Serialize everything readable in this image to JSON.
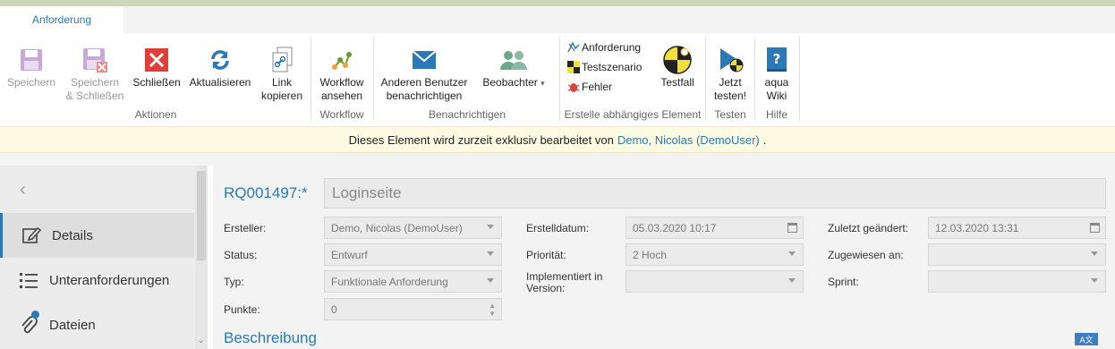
{
  "tab": {
    "label": "Anforderung"
  },
  "ribbon": {
    "buttons": {
      "save": "Speichern",
      "save_close_1": "Speichern",
      "save_close_2": "& Schließen",
      "close": "Schließen",
      "refresh": "Aktualisieren",
      "copy_link_1": "Link",
      "copy_link_2": "kopieren",
      "workflow_1": "Workflow",
      "workflow_2": "ansehen",
      "notify_1": "Anderen Benutzer",
      "notify_2": "benachrichtigen",
      "observers": "Beobachter",
      "dep_requirement": "Anforderung",
      "dep_testscenario": "Testszenario",
      "dep_bug": "Fehler",
      "testcase": "Testfall",
      "test_now_1": "Jetzt",
      "test_now_2": "testen!",
      "wiki_1": "aqua",
      "wiki_2": "Wiki"
    },
    "groups": {
      "actions": "Aktionen",
      "workflow": "Workflow",
      "notify": "Benachrichtigen",
      "create_dependent": "Erstelle abhängiges Element",
      "test": "Testen",
      "help": "Hilfe"
    }
  },
  "banner": {
    "text": "Dieses Element wird zurzeit exklusiv bearbeitet von",
    "user": "Demo, Nicolas (DemoUser)",
    "suffix": "."
  },
  "sidebar": {
    "back": "‹",
    "items": [
      {
        "label": "Details",
        "icon": "edit-icon",
        "active": true
      },
      {
        "label": "Unteranforderungen",
        "icon": "list-icon",
        "active": false
      },
      {
        "label": "Dateien",
        "icon": "paperclip-icon",
        "active": false
      }
    ]
  },
  "form": {
    "id": "RQ001497:*",
    "title": "Loginseite",
    "creator_label": "Ersteller:",
    "creator": "Demo, Nicolas (DemoUser)",
    "status_label": "Status:",
    "status": "Entwurf",
    "type_label": "Typ:",
    "type": "Funktionale Anforderung",
    "points_label": "Punkte:",
    "points": "0",
    "created_label": "Erstelldatum:",
    "created": "05.03.2020 10:17",
    "priority_label": "Priorität:",
    "priority": "2 Hoch",
    "impl_version_label_1": "Implementiert in",
    "impl_version_label_2": "Version:",
    "impl_version": "",
    "modified_label": "Zuletzt geändert:",
    "modified": "12.03.2020 13:31",
    "assigned_label": "Zugewiesen an:",
    "assigned": "",
    "sprint_label": "Sprint:",
    "sprint": ""
  },
  "section": {
    "description": "Beschreibung"
  },
  "colors": {
    "accent": "#2a7ab8",
    "close_red": "#e0403a",
    "banner_bg": "#fdfbe1"
  }
}
